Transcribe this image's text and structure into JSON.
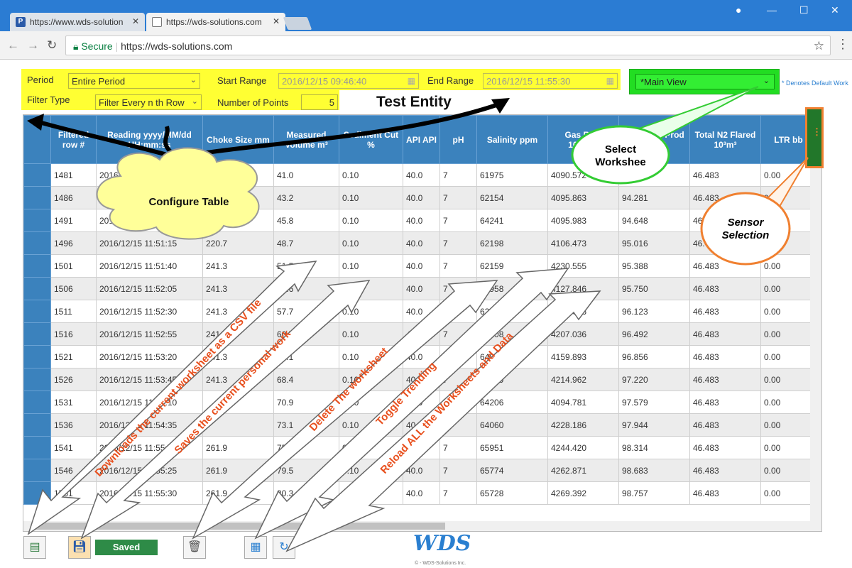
{
  "browser": {
    "tabs": [
      {
        "label": "https://www.wds-solution",
        "favicon": "P"
      },
      {
        "label": "https://wds-solutions.com",
        "favicon": ""
      }
    ],
    "secure_label": "Secure",
    "url": "https://wds-solutions.com"
  },
  "controls": {
    "period_label": "Period",
    "period_value": "Entire Period",
    "filter_type_label": "Filter Type",
    "filter_type_value": "Filter Every n th Row",
    "start_range_label": "Start Range",
    "start_range_value": "2016/12/15 09:46:40",
    "end_range_label": "End Range",
    "end_range_value": "2016/12/15 11:55:30",
    "num_points_label": "Number of Points",
    "num_points_value": "5",
    "view_value": "*Main View",
    "default_note": "* Denotes Default Work"
  },
  "entity_title": "Test Entity",
  "table": {
    "headers": [
      "",
      "Filtered row #",
      "Reading yyyy/MM/dd HH:mm:ss",
      "Choke Size mm",
      "Measured Volume m³",
      "Sediment Cut %",
      "API API",
      "pH",
      "Salinity ppm",
      "Gas Rate 10³m³/d",
      "Total Gas Prod 10³m³",
      "Total N2 Flared 10³m³",
      "LTR bb"
    ],
    "rows": [
      [
        "1481",
        "2016/12/15 11:50:00",
        "",
        "41.0",
        "0.10",
        "40.0",
        "7",
        "61975",
        "4090.572",
        "93.913",
        "46.483",
        "0.00"
      ],
      [
        "1486",
        "2016/12/15 11:50:25",
        "",
        "43.2",
        "0.10",
        "40.0",
        "7",
        "62154",
        "4095.863",
        "94.281",
        "46.483",
        "0.00"
      ],
      [
        "1491",
        "2016/12/15 11:50:50",
        "",
        "45.8",
        "0.10",
        "40.0",
        "7",
        "64241",
        "4095.983",
        "94.648",
        "46.483",
        "0.00"
      ],
      [
        "1496",
        "2016/12/15 11:51:15",
        "220.7",
        "48.7",
        "0.10",
        "40.0",
        "7",
        "62198",
        "4106.473",
        "95.016",
        "46.483",
        "0.00"
      ],
      [
        "1501",
        "2016/12/15 11:51:40",
        "241.3",
        "51.5",
        "0.10",
        "40.0",
        "7",
        "62159",
        "4230.555",
        "95.388",
        "46.483",
        "0.00"
      ],
      [
        "1506",
        "2016/12/15 11:52:05",
        "241.3",
        "54.6",
        "0.10",
        "40.0",
        "7",
        "63958",
        "4127.846",
        "95.750",
        "46.483",
        "0.00"
      ],
      [
        "1511",
        "2016/12/15 11:52:30",
        "241.3",
        "57.7",
        "0.10",
        "40.0",
        "7",
        "62916",
        "4133.076",
        "96.123",
        "46.483",
        "0.00"
      ],
      [
        "1516",
        "2016/12/15 11:52:55",
        "241.3",
        "60.7",
        "0.10",
        "40.0",
        "7",
        "63208",
        "4207.036",
        "96.492",
        "46.483",
        "0.00"
      ],
      [
        "1521",
        "2016/12/15 11:53:20",
        "241.3",
        "64.1",
        "0.10",
        "40.0",
        "7",
        "64024",
        "4159.893",
        "96.856",
        "46.483",
        "0.00"
      ],
      [
        "1526",
        "2016/12/15 11:53:45",
        "241.3",
        "68.4",
        "0.10",
        "40.0",
        "7",
        "64159",
        "4214.962",
        "97.220",
        "46.483",
        "0.00"
      ],
      [
        "1531",
        "2016/12/15 11:54:10",
        "",
        "70.9",
        "0.10",
        "40.0",
        "7",
        "64206",
        "4094.781",
        "97.579",
        "46.483",
        "0.00"
      ],
      [
        "1536",
        "2016/12/15 11:54:35",
        "",
        "73.1",
        "0.10",
        "40.0",
        "7",
        "64060",
        "4228.186",
        "97.944",
        "46.483",
        "0.00"
      ],
      [
        "1541",
        "2016/12/15 11:55:00",
        "261.9",
        "75.8",
        "0.10",
        "40.0",
        "7",
        "65951",
        "4244.420",
        "98.314",
        "46.483",
        "0.00"
      ],
      [
        "1546",
        "2016/12/15 11:55:25",
        "261.9",
        "79.5",
        "0.10",
        "40.0",
        "7",
        "65774",
        "4262.871",
        "98.683",
        "46.483",
        "0.00"
      ],
      [
        "1551",
        "2016/12/15 11:55:30",
        "261.9",
        "80.3",
        "0.10",
        "40.0",
        "7",
        "65728",
        "4269.392",
        "98.757",
        "46.483",
        "0.00"
      ]
    ]
  },
  "bottom": {
    "saved_label": "Saved",
    "logo": "WDS",
    "copyright": "© - WDS-Solutions Inc."
  },
  "callouts": {
    "configure_table": "Configure Table",
    "select_worksheet": "Select Workshee",
    "sensor_selection": "Sensor Selection",
    "download_csv": "Downloads the current worksheet as a CSV file",
    "save_work": "Saves the current personal work",
    "delete_ws": "Delete The worksheet",
    "toggle_trending": "Toggle Trending",
    "reload_all": "Reload ALL the Worksheets and Data"
  },
  "colors": {
    "header_blue": "#3b82bd",
    "highlight_yellow": "#ffff33",
    "view_green": "#22dd22",
    "callout_orange": "#f08030",
    "arrow_text": "#e8501e"
  }
}
